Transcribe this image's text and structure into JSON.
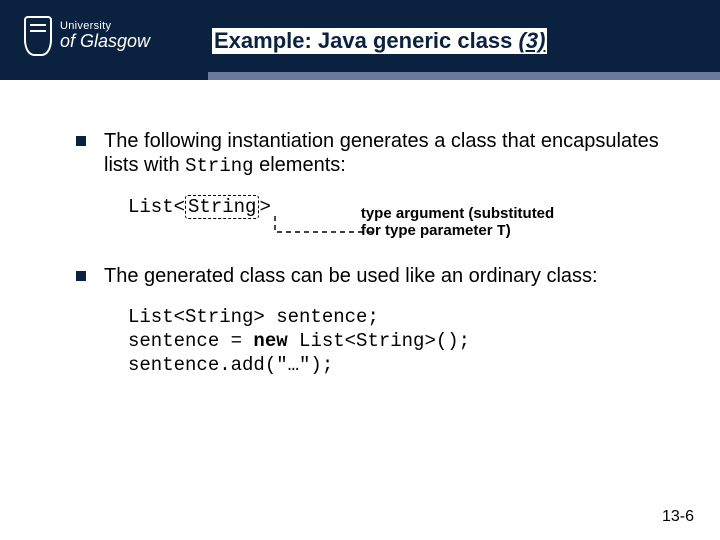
{
  "logo": {
    "line1": "University",
    "line2": "of Glasgow"
  },
  "title": {
    "main": "Example: Java generic class ",
    "suffix": "(3)"
  },
  "bullets": {
    "b1_pre": "The following instantiation generates a class that encapsulates lists with ",
    "b1_code": "String",
    "b1_post": " elements:",
    "b2": "The generated class can be used like an ordinary class:"
  },
  "example1": {
    "prefix": "List<",
    "typearg": "String",
    "suffix": ">"
  },
  "annotation": {
    "line1": "type argument (substituted",
    "line2_pre": "for type parameter ",
    "line2_code": "T",
    "line2_post": ")"
  },
  "codeblock": {
    "l1": "List<String> sentence;",
    "l2_pre": "sentence = ",
    "l2_kw": "new",
    "l2_post": " List<String>();",
    "l3": "sentence.add(\"…\");"
  },
  "page_number": "13-6"
}
